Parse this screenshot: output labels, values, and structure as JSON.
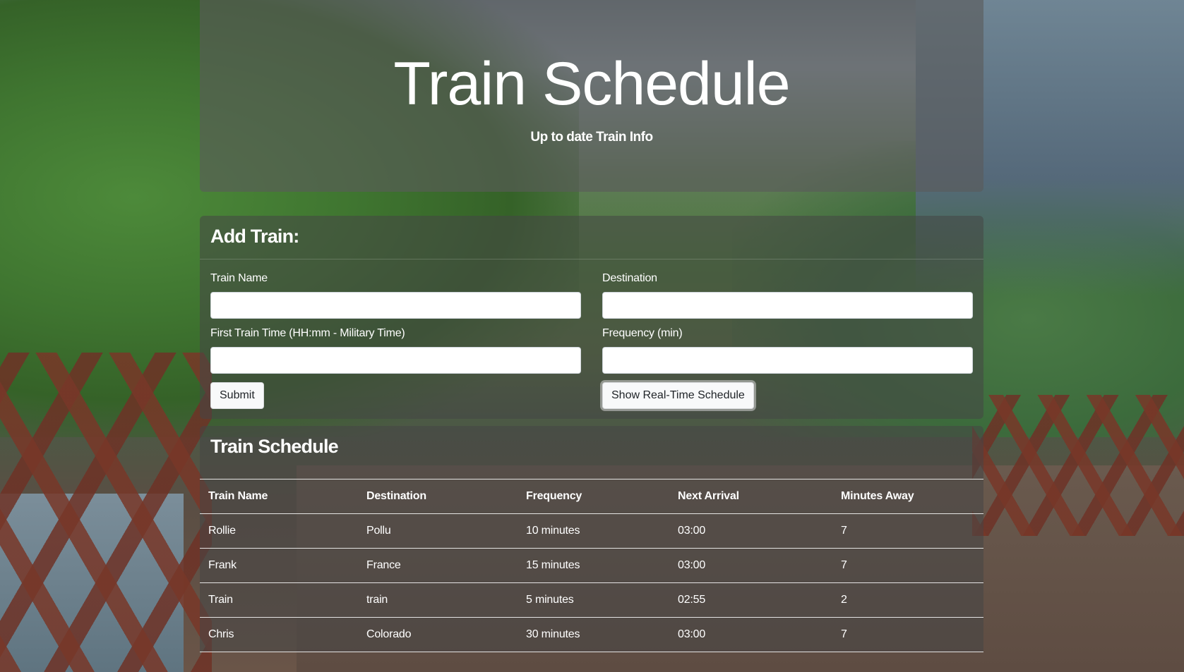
{
  "header": {
    "title": "Train Schedule",
    "subtitle": "Up to date Train Info"
  },
  "add_train": {
    "heading": "Add Train:",
    "fields": {
      "train_name": {
        "label": "Train Name",
        "value": "",
        "placeholder": ""
      },
      "destination": {
        "label": "Destination",
        "value": "",
        "placeholder": ""
      },
      "first_train_time": {
        "label": "First Train Time (HH:mm - Military Time)",
        "value": "",
        "placeholder": ""
      },
      "frequency": {
        "label": "Frequency (min)",
        "value": "",
        "placeholder": ""
      }
    },
    "submit_label": "Submit",
    "realtime_label": "Show Real-Time Schedule"
  },
  "schedule": {
    "heading": "Train Schedule",
    "columns": [
      "Train Name",
      "Destination",
      "Frequency",
      "Next Arrival",
      "Minutes Away"
    ],
    "rows": [
      [
        "Rollie",
        "Pollu",
        "10 minutes",
        "03:00",
        "7"
      ],
      [
        "Frank",
        "France",
        "15 minutes",
        "03:00",
        "7"
      ],
      [
        "Train",
        "train",
        "5 minutes",
        "02:55",
        "2"
      ],
      [
        "Chris",
        "Colorado",
        "30 minutes",
        "03:00",
        "7"
      ]
    ]
  }
}
